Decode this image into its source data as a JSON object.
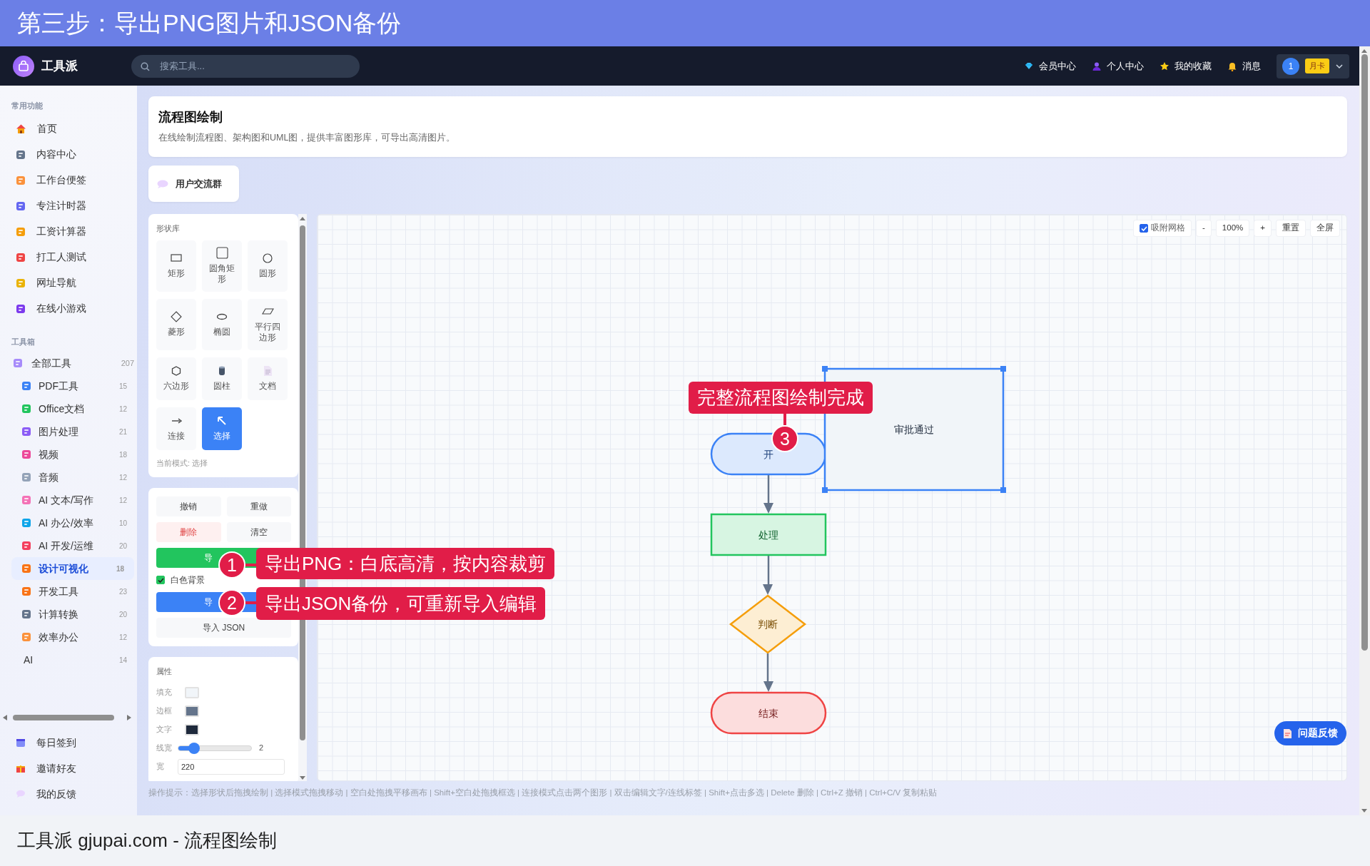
{
  "banner": {
    "title": "第三步：导出PNG图片和JSON备份"
  },
  "navbar": {
    "brand": "工具派",
    "search": {
      "placeholder": "搜索工具..."
    },
    "links": [
      {
        "label": "会员中心",
        "kind": "gem"
      },
      {
        "label": "个人中心",
        "kind": "person"
      },
      {
        "label": "我的收藏",
        "kind": "star"
      },
      {
        "label": "消息",
        "kind": "bell"
      }
    ],
    "user": {
      "avatar": "1",
      "badge": "月卡"
    }
  },
  "sidebar": {
    "sections": [
      {
        "title": "常用功能",
        "items": [
          {
            "label": "首页",
            "kind": "home",
            "selected": false
          },
          {
            "label": "内容中心",
            "kind": "tool",
            "selected": false
          },
          {
            "label": "工作台便签",
            "kind": "tool",
            "selected": false
          },
          {
            "label": "专注计时器",
            "kind": "tool",
            "selected": false
          },
          {
            "label": "工资计算器",
            "kind": "tool",
            "selected": false
          },
          {
            "label": "打工人测试",
            "kind": "tool",
            "selected": false
          },
          {
            "label": "网址导航",
            "kind": "tool",
            "selected": false
          },
          {
            "label": "在线小游戏",
            "kind": "tool",
            "selected": false
          }
        ]
      },
      {
        "title": "工具箱",
        "items": [
          {
            "label": "全部工具",
            "count": "207",
            "kind": "tool",
            "selected": false,
            "children": [
              {
                "label": "PDF工具",
                "count": "15",
                "kind": "tool",
                "selected": false
              },
              {
                "label": "Office文档",
                "count": "12",
                "kind": "tool",
                "selected": false
              },
              {
                "label": "图片处理",
                "count": "21",
                "kind": "tool",
                "selected": false
              },
              {
                "label": "视频",
                "count": "18",
                "kind": "tool",
                "selected": false
              },
              {
                "label": "音频",
                "count": "12",
                "kind": "tool",
                "selected": false
              },
              {
                "label": "AI 文本/写作",
                "count": "12",
                "kind": "tool",
                "selected": false
              },
              {
                "label": "AI 办公/效率",
                "count": "10",
                "kind": "tool",
                "selected": false
              },
              {
                "label": "AI 开发/运维",
                "count": "20",
                "kind": "tool",
                "selected": false
              },
              {
                "label": "设计可视化",
                "count": "18",
                "kind": "tool",
                "selected": true
              },
              {
                "label": "开发工具",
                "count": "23",
                "kind": "tool",
                "selected": false
              },
              {
                "label": "计算转换",
                "count": "20",
                "kind": "tool",
                "selected": false
              },
              {
                "label": "效率办公",
                "count": "12",
                "kind": "tool",
                "selected": false
              },
              {
                "label": "AI",
                "count": "14",
                "kind": "plain",
                "selected": false
              }
            ]
          }
        ]
      }
    ],
    "footer_items": [
      {
        "label": "每日签到",
        "selected": false
      },
      {
        "label": "邀请好友",
        "selected": false
      },
      {
        "label": "我的反馈",
        "selected": false
      }
    ]
  },
  "page_header": {
    "title": "流程图绘制",
    "subtitle": "在线绘制流程图、架构图和UML图，提供丰富图形库，可导出高清图片。"
  },
  "community_button": {
    "label": "用户交流群"
  },
  "shape_library": {
    "title": "形状库",
    "shapes": [
      {
        "label": "矩形",
        "kind": "rect",
        "selected": false
      },
      {
        "label": "圆角矩形",
        "kind": "rounded-rect",
        "selected": false
      },
      {
        "label": "圆形",
        "kind": "circle",
        "selected": false
      },
      {
        "label": "菱形",
        "kind": "diamond",
        "selected": false
      },
      {
        "label": "椭圆",
        "kind": "ellipse",
        "selected": false
      },
      {
        "label": "平行四边形",
        "kind": "parallelogram",
        "selected": false
      },
      {
        "label": "六边形",
        "kind": "hexagon",
        "selected": false
      },
      {
        "label": "圆柱",
        "kind": "cylinder",
        "selected": false
      },
      {
        "label": "文档",
        "kind": "document",
        "selected": false
      },
      {
        "label": "连接",
        "kind": "connect",
        "selected": false
      },
      {
        "label": "选择",
        "kind": "select",
        "selected": true
      }
    ],
    "mode": "当前模式: 选择"
  },
  "actions": {
    "buttons": [
      {
        "label": "撤销",
        "kind": "plain"
      },
      {
        "label": "重做",
        "kind": "plain"
      },
      {
        "label": "删除",
        "kind": "danger"
      },
      {
        "label": "清空",
        "kind": "plain"
      },
      {
        "label": "导",
        "kind": "success"
      },
      {
        "label": "白色背景",
        "kind": "checkbox",
        "checked": true
      },
      {
        "label": "导",
        "kind": "primary"
      },
      {
        "label": "导入 JSON",
        "kind": "plain"
      }
    ]
  },
  "properties": {
    "title": "属性",
    "colors": [
      {
        "label": "填充",
        "color": "#f1f5f9"
      },
      {
        "label": "边框",
        "color": "#64748b"
      },
      {
        "label": "文字",
        "color": "#1e293b"
      }
    ],
    "line_width": {
      "label": "线宽",
      "level": 0.22,
      "reading": "2"
    },
    "width": {
      "label": "宽",
      "value": "220"
    }
  },
  "canvas": {
    "snap_grid": {
      "label": "吸附网格",
      "checked": true
    },
    "zoom_buttons": [
      "-",
      "100%",
      "+",
      "重置",
      "全屏"
    ],
    "nodes": [
      {
        "label": "开",
        "kind": "terminal",
        "color": "#3b82f6",
        "selected": false
      },
      {
        "label": "处理",
        "kind": "process",
        "color": "#22c55e",
        "selected": false
      },
      {
        "label": "判断",
        "kind": "decision",
        "color": "#f59e0b",
        "selected": false
      },
      {
        "label": "结束",
        "kind": "terminal",
        "color": "#ef4444",
        "selected": false
      },
      {
        "label": "审批通过",
        "kind": "process",
        "selected": true
      }
    ]
  },
  "feedback_button": {
    "label": "问题反馈"
  },
  "hint": "操作提示：选择形状后拖拽绘制 | 选择模式拖拽移动 | 空白处拖拽平移画布 | Shift+空白处拖拽框选 | 连接模式点击两个图形 | 双击编辑文字/连线标签 | Shift+点击多选 | Delete 删除 | Ctrl+Z 撤销 | Ctrl+C/V 复制粘贴",
  "annotations": [
    {
      "number": "1",
      "text": "导出PNG：白底高清，按内容裁剪"
    },
    {
      "number": "2",
      "text": "导出JSON备份，可重新导入编辑"
    },
    {
      "number": "3",
      "text": "完整流程图绘制完成"
    }
  ],
  "caption": "工具派 gjupai.com - 流程图绘制"
}
